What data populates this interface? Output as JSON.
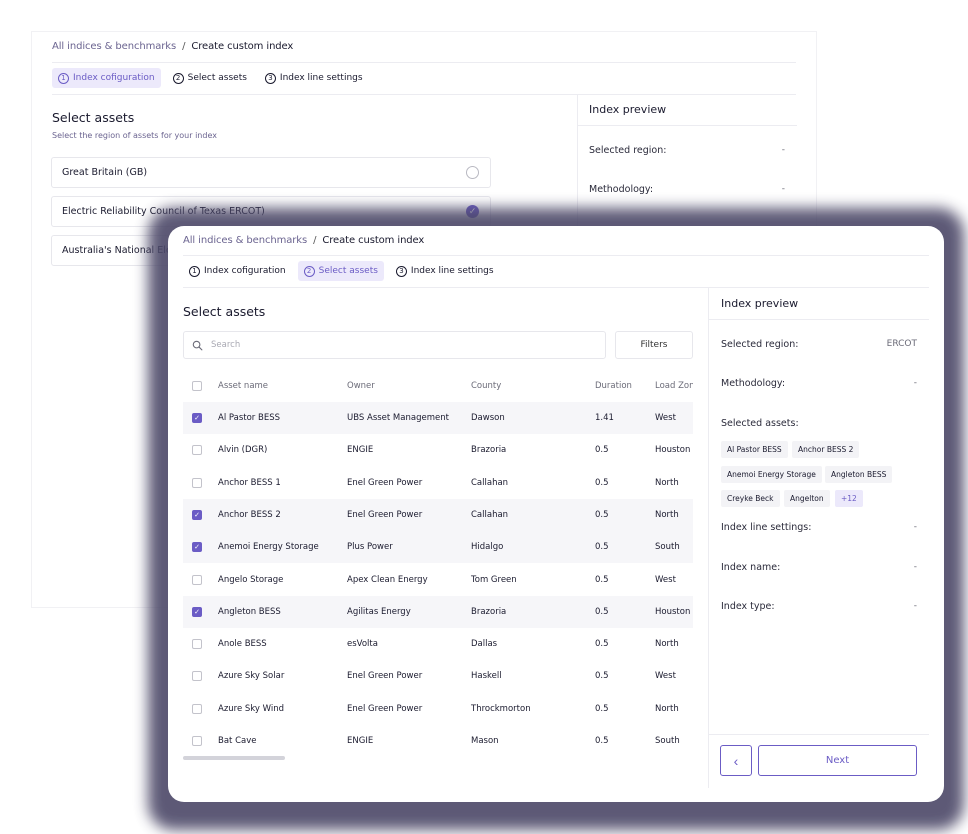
{
  "back": {
    "breadcrumb": {
      "parent": "All indices & benchmarks",
      "separator": "/",
      "current": "Create custom index"
    },
    "steps": [
      {
        "num": "1",
        "label": "Index cofiguration",
        "active": true
      },
      {
        "num": "2",
        "label": "Select assets",
        "active": false
      },
      {
        "num": "3",
        "label": "Index line settings",
        "active": false
      }
    ],
    "section_title": "Select assets",
    "section_subtitle": "Select the region of assets for your index",
    "regions": [
      {
        "label": "Great Britain (GB)",
        "selected": false
      },
      {
        "label": "Electric Reliability Council of Texas ERCOT)",
        "selected": true
      },
      {
        "label": "Australia's National Ele",
        "selected": false
      }
    ],
    "preview": {
      "title": "Index preview",
      "rows": [
        {
          "label": "Selected region:",
          "value": "-"
        },
        {
          "label": "Methodology:",
          "value": "-"
        }
      ]
    }
  },
  "front": {
    "breadcrumb": {
      "parent": "All indices & benchmarks",
      "separator": "/",
      "current": "Create custom index"
    },
    "steps": [
      {
        "num": "1",
        "label": "Index cofiguration",
        "active": false
      },
      {
        "num": "2",
        "label": "Select assets",
        "active": true
      },
      {
        "num": "3",
        "label": "Index line settings",
        "active": false
      }
    ],
    "section_title": "Select assets",
    "search": {
      "placeholder": "Search",
      "icon": "search-icon"
    },
    "filters_label": "Filters",
    "table": {
      "columns": [
        "Asset name",
        "Owner",
        "County",
        "Duration",
        "Load Zon"
      ],
      "rows": [
        {
          "checked": true,
          "cells": [
            "Al Pastor BESS",
            "UBS Asset Management",
            "Dawson",
            "1.41",
            "West"
          ]
        },
        {
          "checked": false,
          "cells": [
            "Alvin (DGR)",
            "ENGIE",
            "Brazoria",
            "0.5",
            "Houston"
          ]
        },
        {
          "checked": false,
          "cells": [
            "Anchor BESS 1",
            "Enel Green Power",
            "Callahan",
            "0.5",
            "North"
          ]
        },
        {
          "checked": true,
          "cells": [
            "Anchor BESS 2",
            "Enel Green Power",
            "Callahan",
            "0.5",
            "North"
          ]
        },
        {
          "checked": true,
          "cells": [
            "Anemoi Energy Storage",
            "Plus Power",
            "Hidalgo",
            "0.5",
            "South"
          ]
        },
        {
          "checked": false,
          "cells": [
            "Angelo Storage",
            "Apex Clean Energy",
            "Tom Green",
            "0.5",
            "West"
          ]
        },
        {
          "checked": true,
          "cells": [
            "Angleton BESS",
            "Agilitas Energy",
            "Brazoria",
            "0.5",
            "Houston"
          ]
        },
        {
          "checked": false,
          "cells": [
            "Anole BESS",
            "esVolta",
            "Dallas",
            "0.5",
            "North"
          ]
        },
        {
          "checked": false,
          "cells": [
            "Azure Sky Solar",
            "Enel Green Power",
            "Haskell",
            "0.5",
            "West"
          ]
        },
        {
          "checked": false,
          "cells": [
            "Azure Sky Wind",
            "Enel Green Power",
            "Throckmorton",
            "0.5",
            "North"
          ]
        },
        {
          "checked": false,
          "cells": [
            "Bat Cave",
            "ENGIE",
            "Mason",
            "0.5",
            "South"
          ]
        }
      ]
    },
    "preview": {
      "title": "Index preview",
      "selected_region_label": "Selected region:",
      "selected_region_value": "ERCOT",
      "methodology_label": "Methodology:",
      "methodology_value": "-",
      "selected_assets_label": "Selected assets:",
      "asset_tags": [
        "Al Pastor BESS",
        "Anchor BESS 2",
        "Anemoi Energy Storage",
        "Angleton BESS",
        "Creyke Beck",
        "Angelton"
      ],
      "more_tag": "+12",
      "index_line_settings_label": "Index line settings:",
      "index_line_settings_value": "-",
      "index_name_label": "Index name:",
      "index_name_value": "-",
      "index_type_label": "Index type:",
      "index_type_value": "-"
    },
    "buttons": {
      "back_icon": "chevron-left-icon",
      "back_glyph": "‹",
      "next_label": "Next"
    }
  },
  "colors": {
    "accent": "#6b5cc5",
    "accent_bg": "#ece9fb",
    "backdrop": "#4c4868"
  }
}
